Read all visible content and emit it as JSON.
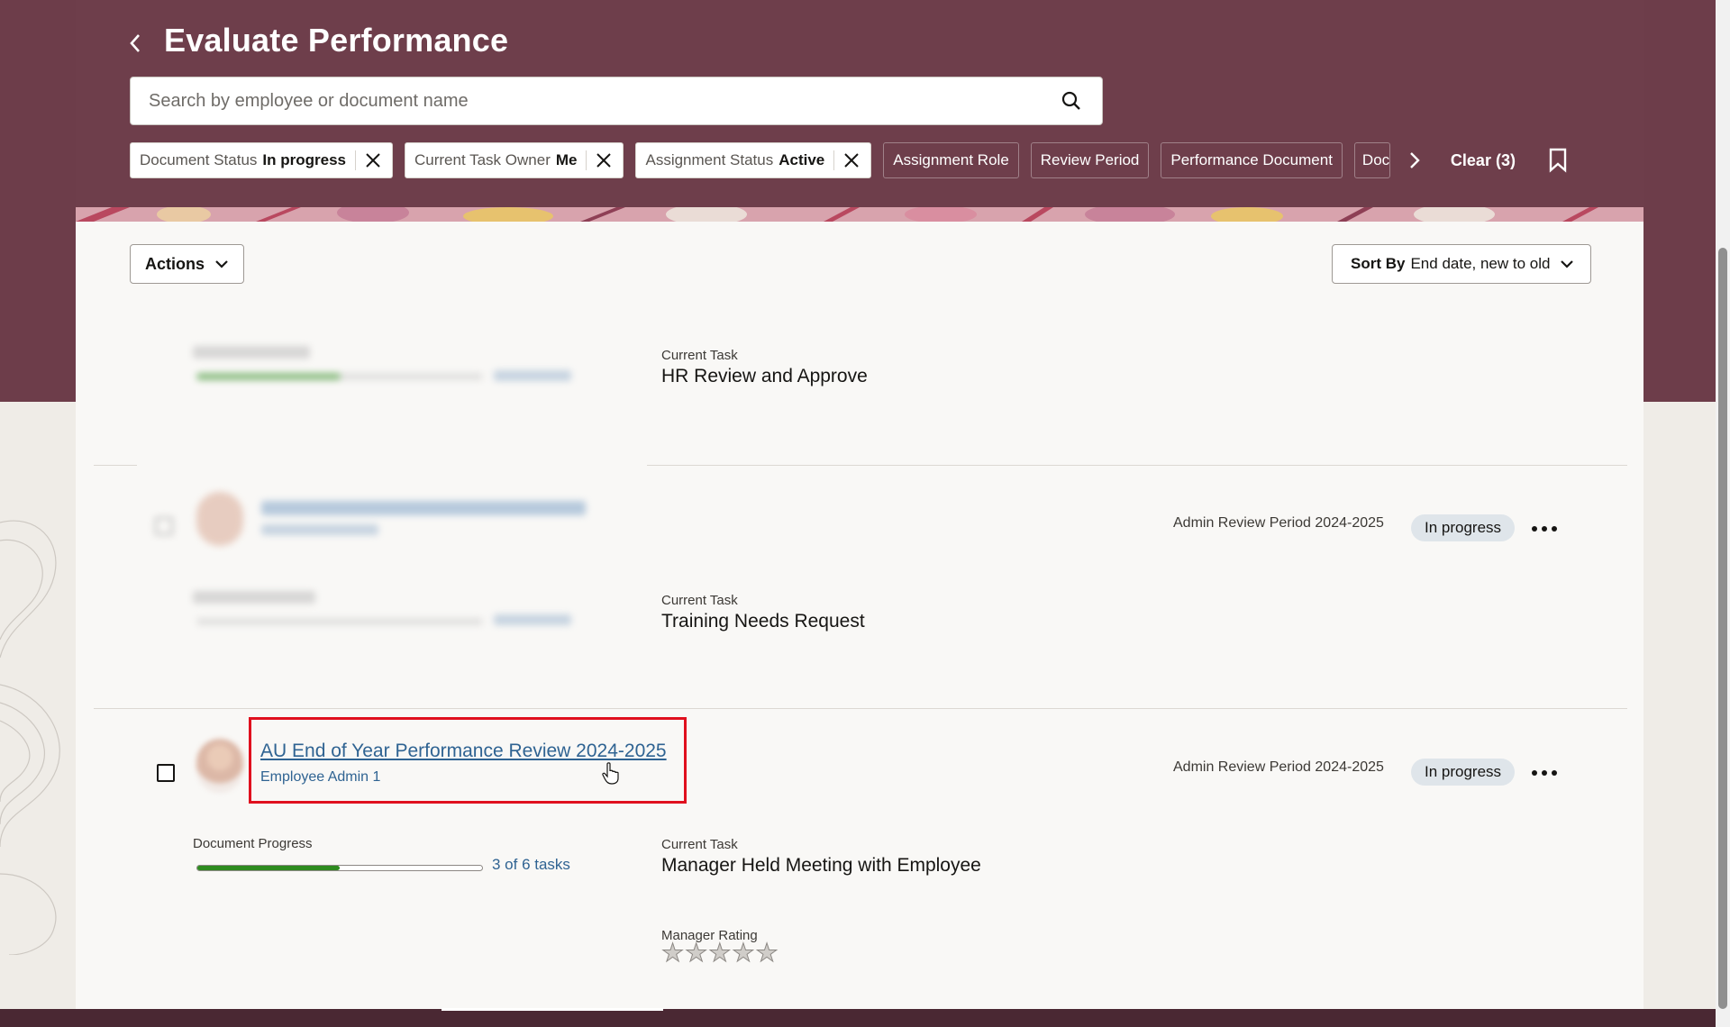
{
  "page": {
    "title": "Evaluate Performance",
    "colors": {
      "brand": "#6d3d4a",
      "link": "#2f6392",
      "highlight": "#e0101e",
      "progress": "#2e8b1f"
    }
  },
  "search": {
    "placeholder": "Search by employee or document name",
    "value": ""
  },
  "filters": {
    "chips": [
      {
        "label": "Document Status",
        "value": "In progress"
      },
      {
        "label": "Current Task Owner",
        "value": "Me"
      },
      {
        "label": "Assignment Status",
        "value": "Active"
      }
    ],
    "plain": [
      "Assignment Role",
      "Review Period",
      "Performance Document",
      "Doc"
    ],
    "clear_label": "Clear (3)"
  },
  "toolbar": {
    "actions_label": "Actions",
    "sort_prefix": "Sort By",
    "sort_value": "End date, new to old"
  },
  "rows": [
    {
      "current_task_label": "Current Task",
      "current_task": "HR Review and Approve"
    },
    {
      "period": "Admin Review Period 2024-2025",
      "status": "In progress",
      "current_task_label": "Current Task",
      "current_task": "Training Needs Request"
    },
    {
      "document_name": "AU End of Year Performance Review 2024-2025",
      "employee": "Employee Admin 1",
      "period": "Admin Review Period 2024-2025",
      "status": "In progress",
      "progress_label": "Document Progress",
      "progress_fraction": 0.5,
      "progress_text": "3 of 6 tasks",
      "current_task_label": "Current Task",
      "current_task": "Manager Held Meeting with Employee",
      "rating_label": "Manager Rating",
      "rating_stars_filled": 0,
      "rating_stars_total": 5
    }
  ],
  "icons": [
    "chevron-left-icon",
    "search-icon",
    "close-icon",
    "chevron-right-icon",
    "bookmark-icon",
    "chevron-down-icon",
    "more-icon",
    "star-icon",
    "pointer-cursor-icon"
  ]
}
